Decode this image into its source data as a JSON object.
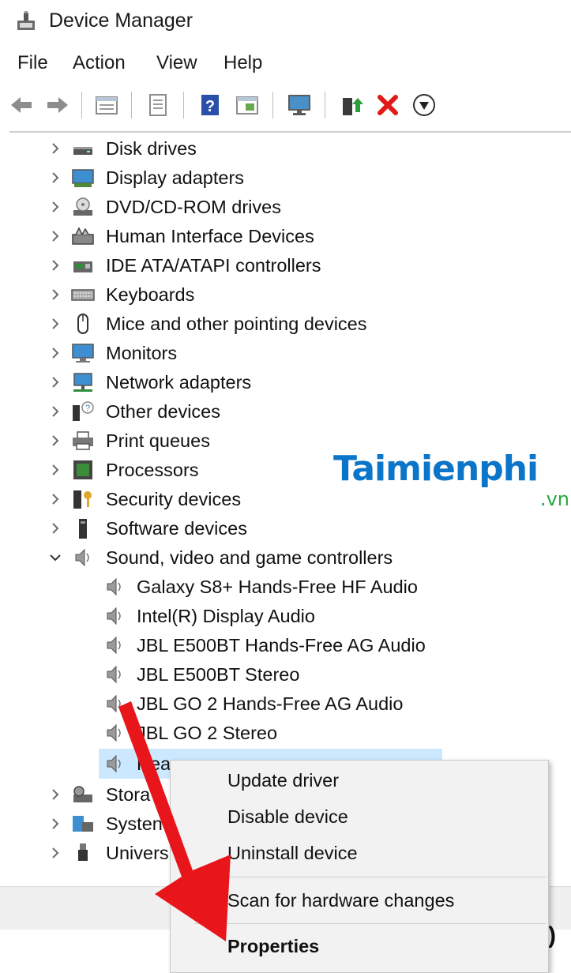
{
  "window": {
    "title": "Device Manager"
  },
  "menu": [
    "File",
    "Action",
    "View",
    "Help"
  ],
  "toolbar": {
    "icons": [
      "back-arrow-icon",
      "forward-arrow-icon",
      "properties-grid-icon",
      "document-icon",
      "help-icon",
      "view-icon",
      "monitor-icon",
      "update-driver-icon",
      "remove-icon",
      "download-icon"
    ]
  },
  "tree": {
    "categories": [
      {
        "label": "Disk drives",
        "icon": "disk-drive-icon"
      },
      {
        "label": "Display adapters",
        "icon": "display-adapter-icon"
      },
      {
        "label": "DVD/CD-ROM drives",
        "icon": "dvd-drive-icon"
      },
      {
        "label": "Human Interface Devices",
        "icon": "hid-icon"
      },
      {
        "label": "IDE ATA/ATAPI controllers",
        "icon": "ide-controller-icon"
      },
      {
        "label": "Keyboards",
        "icon": "keyboard-icon"
      },
      {
        "label": "Mice and other pointing devices",
        "icon": "mouse-icon"
      },
      {
        "label": "Monitors",
        "icon": "monitor-icon"
      },
      {
        "label": "Network adapters",
        "icon": "network-adapter-icon"
      },
      {
        "label": "Other devices",
        "icon": "other-devices-icon"
      },
      {
        "label": "Print queues",
        "icon": "printer-icon"
      },
      {
        "label": "Processors",
        "icon": "processor-icon"
      },
      {
        "label": "Security devices",
        "icon": "security-device-icon"
      },
      {
        "label": "Software devices",
        "icon": "software-device-icon"
      },
      {
        "label": "Sound, video and game controllers",
        "icon": "speaker-icon",
        "expanded": true
      }
    ],
    "sound_children": [
      "Galaxy S8+ Hands-Free HF Audio",
      "Intel(R) Display Audio",
      "JBL E500BT Hands-Free AG Audio",
      "JBL E500BT Stereo",
      "JBL GO 2 Hands-Free AG Audio",
      "JBL GO 2 Stereo",
      "Rea"
    ],
    "after": [
      {
        "label": "Stora",
        "icon": "storage-icon"
      },
      {
        "label": "Systen",
        "icon": "system-device-icon"
      },
      {
        "label": "Univers",
        "icon": "usb-icon"
      }
    ]
  },
  "context_menu": {
    "items": [
      "Update driver",
      "Disable device",
      "Uninstall device",
      "Scan for hardware changes",
      "Properties"
    ]
  },
  "watermark": {
    "main": "Taimienphi",
    "sub": ".vn"
  },
  "colors": {
    "accent": "#0b75c9",
    "selection": "#cce8ff",
    "arrow": "#e8161b",
    "watermark_sub": "#27a844"
  }
}
